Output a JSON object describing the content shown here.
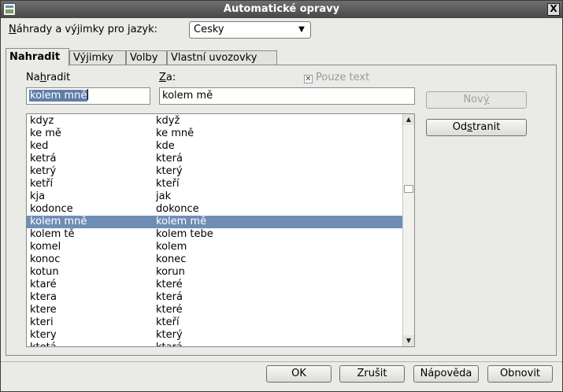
{
  "window": {
    "title": "Automatické opravy",
    "close_glyph": "X"
  },
  "language": {
    "label_pre": "",
    "label_accel": "N",
    "label_post": "áhrady a výjimky pro jazyk:",
    "value": "Cesky",
    "arrow": "▼"
  },
  "tabs": [
    {
      "label": "Nahradit"
    },
    {
      "label": "Výjimky"
    },
    {
      "label": "Volby"
    },
    {
      "label": "Vlastní uvozovky"
    }
  ],
  "replace": {
    "label_pre": "Na",
    "label_accel": "h",
    "label_post": "radit",
    "value": "kolem mně"
  },
  "with": {
    "label_pre": "",
    "label_accel": "Z",
    "label_post": "a:",
    "value": "kolem mě"
  },
  "text_only": {
    "label": "Pouze text",
    "checked_glyph": "✕"
  },
  "list": {
    "rows": [
      {
        "a": "kdyz",
        "b": "když"
      },
      {
        "a": "ke mě",
        "b": "ke mně"
      },
      {
        "a": "ked",
        "b": "kde"
      },
      {
        "a": "ketrá",
        "b": "která"
      },
      {
        "a": "ketrý",
        "b": "který"
      },
      {
        "a": "ketří",
        "b": "kteří"
      },
      {
        "a": "kja",
        "b": "jak"
      },
      {
        "a": "kodonce",
        "b": "dokonce"
      },
      {
        "a": "kolem mně",
        "b": "kolem mě"
      },
      {
        "a": "kolem tě",
        "b": "kolem tebe"
      },
      {
        "a": "komel",
        "b": "kolem"
      },
      {
        "a": "konoc",
        "b": "konec"
      },
      {
        "a": "kotun",
        "b": "korun"
      },
      {
        "a": "ktaré",
        "b": "které"
      },
      {
        "a": "ktera",
        "b": "která"
      },
      {
        "a": "ktere",
        "b": "které"
      },
      {
        "a": "kteri",
        "b": "kteří"
      },
      {
        "a": "ktery",
        "b": "který"
      },
      {
        "a": "ktetá",
        "b": "ktará"
      }
    ],
    "selected_index": 8,
    "scroll_up": "▲",
    "scroll_down": "▼"
  },
  "buttons": {
    "new_pre": "Nov",
    "new_accel": "ý",
    "new_post": "",
    "delete_pre": "Od",
    "delete_accel": "s",
    "delete_post": "tranit"
  },
  "footer": {
    "ok": "OK",
    "cancel": "Zrušit",
    "help": "Nápověda",
    "reset": "Obnovit"
  }
}
